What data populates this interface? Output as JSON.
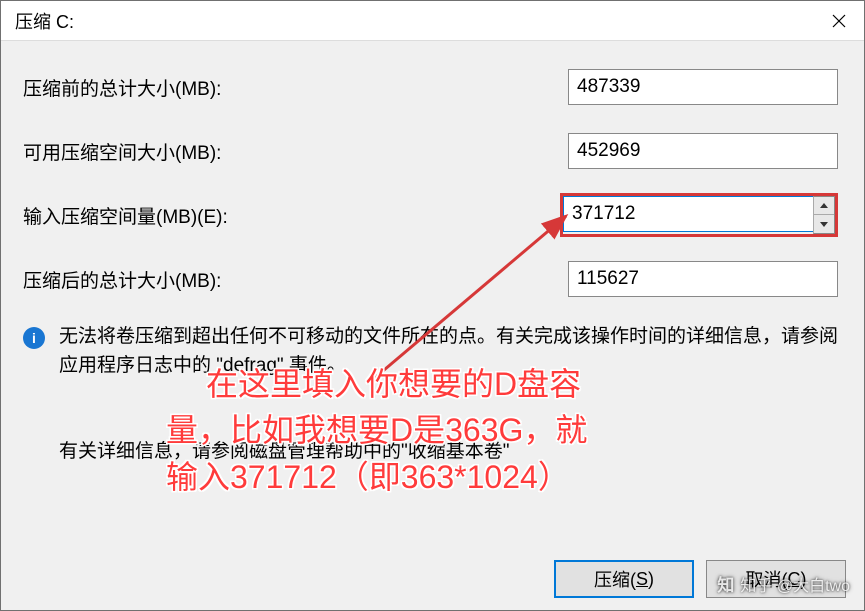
{
  "title": "压缩 C:",
  "fields": {
    "total_before_label": "压缩前的总计大小(MB):",
    "total_before_value": "487339",
    "available_label": "可用压缩空间大小(MB):",
    "available_value": "452969",
    "shrink_input_label": "输入压缩空间量(MB)(E):",
    "shrink_input_value": "371712",
    "total_after_label": "压缩后的总计大小(MB):",
    "total_after_value": "115627"
  },
  "info_text_1": "无法将卷压缩到超出任何不可移动的文件所在的点。有关完成该操作时间的详细信息，请参阅应用程序日志中的 \"defrag\" 事件。",
  "info_text_2": "有关详细信息，请参阅磁盘管理帮助中的\"收缩基本卷\"",
  "buttons": {
    "shrink": "压缩(",
    "shrink_m": "S",
    "shrink_e": ")",
    "cancel": "取消(",
    "cancel_m": "C",
    "cancel_e": ")"
  },
  "annotation": {
    "line1": "在这里填入你想要的D盘容",
    "line2": "量，比如我想要D是363G，就",
    "line3": "输入371712（即363*1024）"
  },
  "watermark": "知乎 @大白two"
}
